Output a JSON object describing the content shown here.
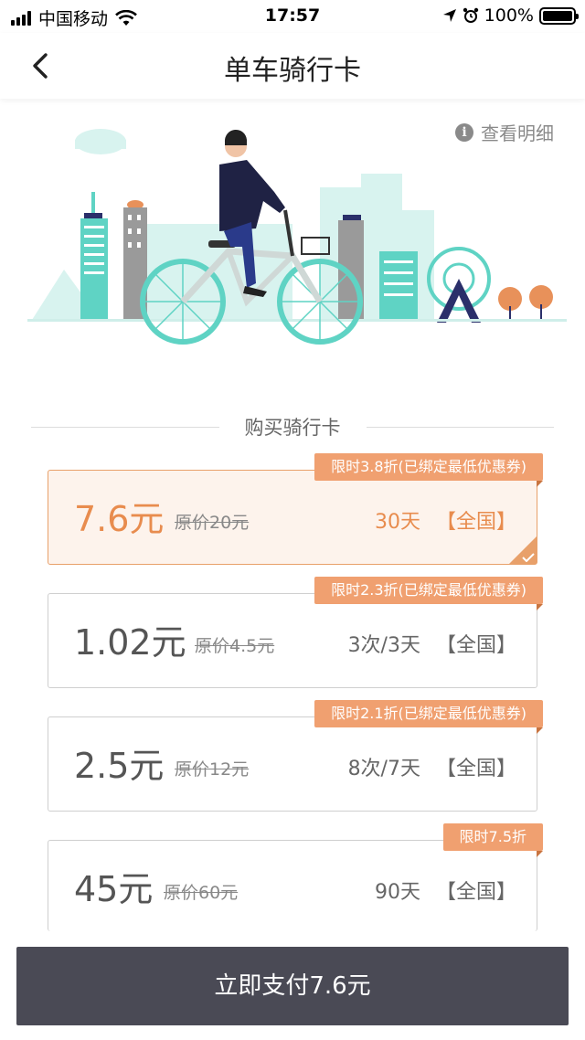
{
  "status_bar": {
    "carrier": "中国移动",
    "time": "17:57",
    "battery": "100%"
  },
  "nav": {
    "title": "单车骑行卡"
  },
  "detail_link": "查看明细",
  "section_title": "购买骑行卡",
  "cards": [
    {
      "badge": "限时3.8折(已绑定最低优惠券)",
      "price": "7.6元",
      "original": "原价20元",
      "duration": "30天",
      "scope": "【全国】",
      "selected": true
    },
    {
      "badge": "限时2.3折(已绑定最低优惠券)",
      "price": "1.02元",
      "original": "原价4.5元",
      "duration": "3次/3天",
      "scope": "【全国】",
      "selected": false
    },
    {
      "badge": "限时2.1折(已绑定最低优惠券)",
      "price": "2.5元",
      "original": "原价12元",
      "duration": "8次/7天",
      "scope": "【全国】",
      "selected": false
    },
    {
      "badge": "限时7.5折",
      "price": "45元",
      "original": "原价60元",
      "duration": "90天",
      "scope": "【全国】",
      "selected": false
    }
  ],
  "pay_button": "立即支付7.6元",
  "colors": {
    "accent": "#e88c4e",
    "badge": "#f0a070",
    "teal": "#5fd3c4",
    "button": "#4a4a55"
  }
}
